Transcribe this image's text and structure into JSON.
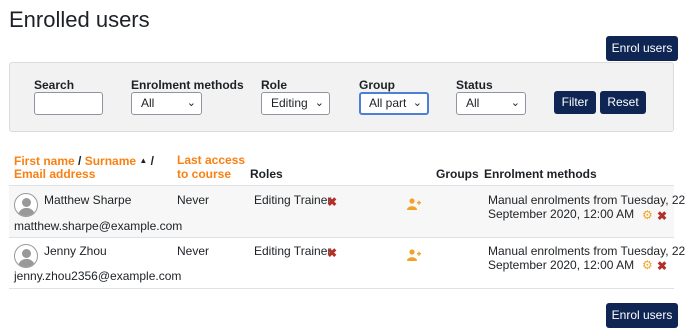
{
  "page": {
    "title": "Enrolled users"
  },
  "actions": {
    "enrol_top": "Enrol users",
    "enrol_bottom": "Enrol users"
  },
  "filters": {
    "search_label": "Search",
    "search_value": "",
    "methods_label": "Enrolment methods",
    "methods_value": "All",
    "role_label": "Role",
    "role_value": "Editing",
    "group_label": "Group",
    "group_value": "All part",
    "status_label": "Status",
    "status_value": "All",
    "filter_btn": "Filter",
    "reset_btn": "Reset"
  },
  "table": {
    "headers": {
      "first_name": "First name",
      "slash1": " / ",
      "surname": "Surname",
      "sort_arrow": "▲",
      "slash2": " /",
      "email": "Email address",
      "last_access_1": "Last access",
      "last_access_2": "to course",
      "roles": "Roles",
      "groups": "Groups",
      "enrol_methods": "Enrolment methods"
    },
    "rows": [
      {
        "name": "Matthew Sharpe",
        "email": "matthew.sharpe@example.com",
        "last_access": "Never",
        "role": "Editing Trainer",
        "enrol_line1": "Manual enrolments from Tuesday, 22",
        "enrol_line2": "September 2020, 12:00 AM"
      },
      {
        "name": "Jenny Zhou",
        "email": "jenny.zhou2356@example.com",
        "last_access": "Never",
        "role": "Editing Trainer",
        "enrol_line1": "Manual enrolments from Tuesday, 22",
        "enrol_line2": "September 2020, 12:00 AM"
      }
    ]
  },
  "icons": {
    "remove": "✖",
    "gear": "⚙",
    "chevron": "⌄"
  },
  "colors": {
    "primary": "#0f2655",
    "link": "#f98012",
    "danger": "#b3302a",
    "gear": "#f0a32b"
  }
}
